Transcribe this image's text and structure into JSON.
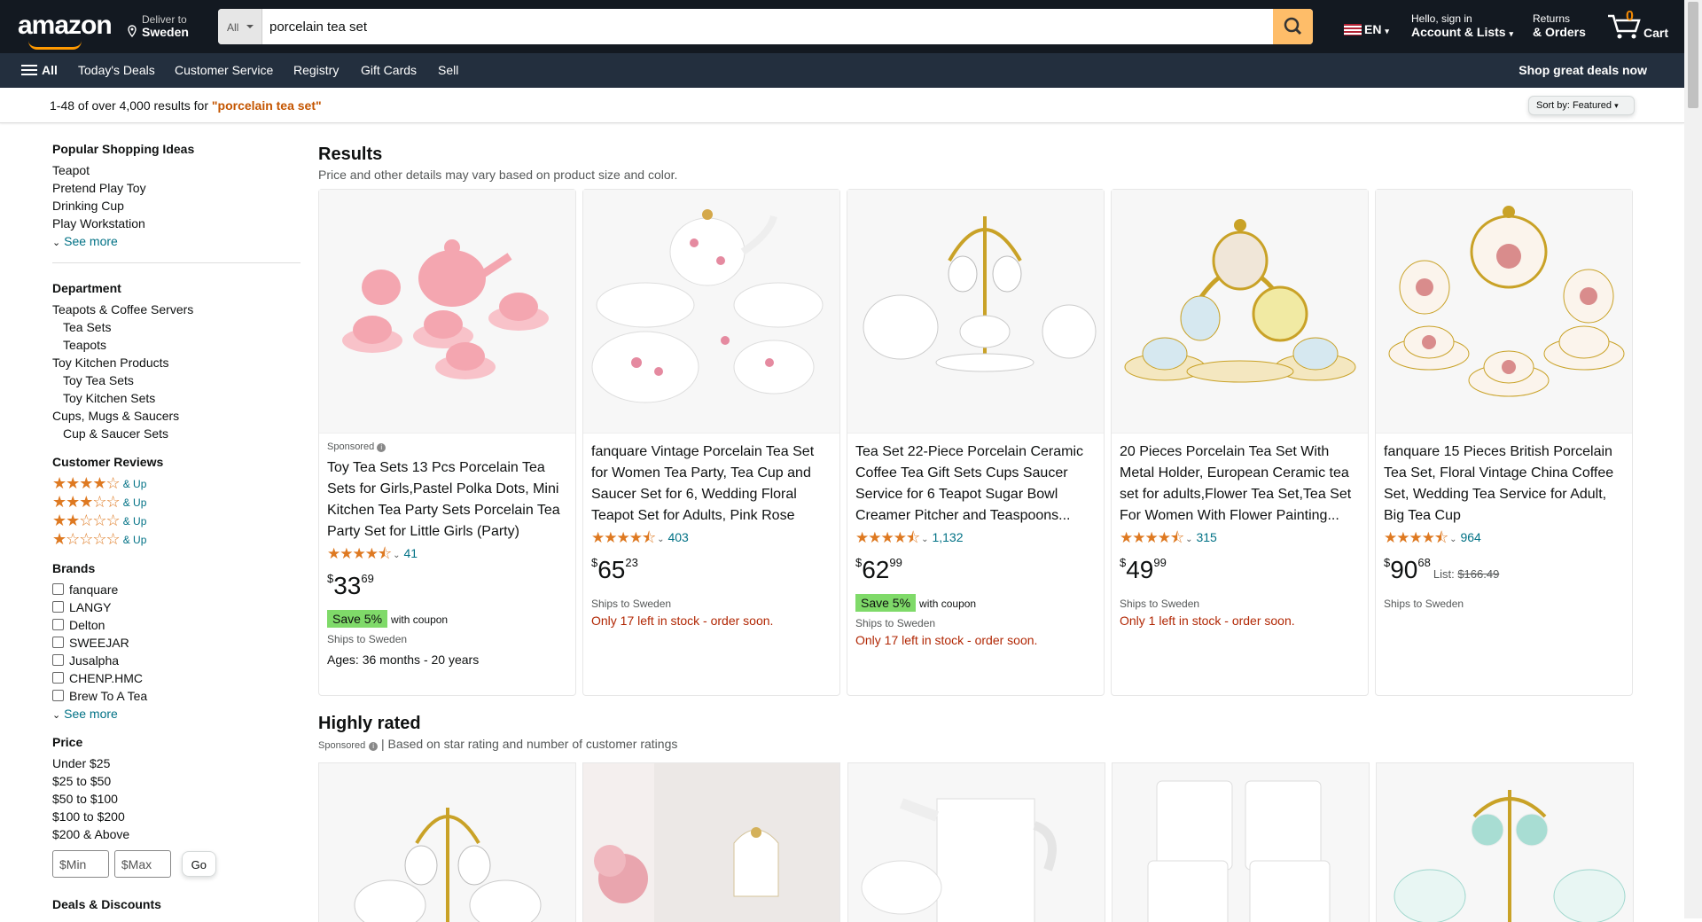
{
  "header": {
    "logo": "amazon",
    "deliver_label": "Deliver to",
    "deliver_country": "Sweden",
    "search_category": "All",
    "search_value": "porcelain tea set",
    "language": "EN",
    "account_greeting": "Hello, sign in",
    "account_label": "Account & Lists",
    "returns_label": "Returns",
    "orders_label": "& Orders",
    "cart_count": "0",
    "cart_label": "Cart"
  },
  "nav": {
    "all": "All",
    "items": [
      "Today's Deals",
      "Customer Service",
      "Registry",
      "Gift Cards",
      "Sell"
    ],
    "promo": "Shop great deals now"
  },
  "results_bar": {
    "prefix": "1-48 of over 4,000 results for ",
    "query": "\"porcelain tea set\"",
    "sort": "Sort by:  Featured"
  },
  "sidebar": {
    "popular_title": "Popular Shopping Ideas",
    "popular": [
      "Teapot",
      "Pretend Play Toy",
      "Drinking Cup",
      "Play Workstation"
    ],
    "see_more": "See more",
    "department_title": "Department",
    "departments": [
      {
        "label": "Teapots & Coffee Servers",
        "indent": false
      },
      {
        "label": "Tea Sets",
        "indent": true
      },
      {
        "label": "Teapots",
        "indent": true
      },
      {
        "label": "Toy Kitchen Products",
        "indent": false
      },
      {
        "label": "Toy Tea Sets",
        "indent": true
      },
      {
        "label": "Toy Kitchen Sets",
        "indent": true
      },
      {
        "label": "Cups, Mugs & Saucers",
        "indent": false
      },
      {
        "label": "Cup & Saucer Sets",
        "indent": true
      }
    ],
    "reviews_title": "Customer Reviews",
    "review_rows": [
      4,
      3,
      2,
      1
    ],
    "and_up": "& Up",
    "brands_title": "Brands",
    "brands": [
      "fanquare",
      "LANGY",
      "Delton",
      "SWEEJAR",
      "Jusalpha",
      "CHENP.HMC",
      "Brew To A Tea"
    ],
    "price_title": "Price",
    "prices": [
      "Under $25",
      "$25 to $50",
      "$50 to $100",
      "$100 to $200",
      "$200 & Above"
    ],
    "min_placeholder": "$Min",
    "max_placeholder": "$Max",
    "go": "Go",
    "deals_title": "Deals & Discounts"
  },
  "results": {
    "title": "Results",
    "subtitle": "Price and other details may vary based on product size and color.",
    "products": [
      {
        "sponsored": "Sponsored",
        "title": "Toy Tea Sets 13 Pcs Porcelain Tea Sets for Girls,Pastel Polka Dots, Mini Kitchen Tea Party Sets Porcelain Tea Party Set for Little Girls (Party)",
        "rating": 4.5,
        "reviews": "41",
        "price_whole": "33",
        "price_cents": "69",
        "list_price": "",
        "coupon": "Save 5%",
        "coupon_text": "with coupon",
        "ships": "Ships to Sweden",
        "stock": "",
        "ages": "Ages: 36 months - 20 years",
        "img": "pink"
      },
      {
        "sponsored": "",
        "title": "fanquare Vintage Porcelain Tea Set for Women Tea Party, Tea Cup and Saucer Set for 6, Wedding Floral Teapot Set for Adults, Pink Rose",
        "rating": 4.5,
        "reviews": "403",
        "price_whole": "65",
        "price_cents": "23",
        "list_price": "",
        "coupon": "",
        "coupon_text": "",
        "ships": "Ships to Sweden",
        "stock": "Only 17 left in stock - order soon.",
        "ages": "",
        "img": "floral"
      },
      {
        "sponsored": "",
        "title": "Tea Set 22-Piece Porcelain Ceramic Coffee Tea Gift Sets Cups Saucer Service for 6 Teapot Sugar Bowl Creamer Pitcher and Teaspoons...",
        "rating": 4.5,
        "reviews": "1,132",
        "price_whole": "62",
        "price_cents": "99",
        "list_price": "",
        "coupon": "Save 5%",
        "coupon_text": "with coupon",
        "ships": "Ships to Sweden",
        "stock": "Only 17 left in stock - order soon.",
        "ages": "",
        "img": "rack"
      },
      {
        "sponsored": "",
        "title": "20 Pieces Porcelain Tea Set With Metal Holder, European Ceramic tea set for adults,Flower Tea Set,Tea Set For Women With Flower Painting...",
        "rating": 4.5,
        "reviews": "315",
        "price_whole": "49",
        "price_cents": "99",
        "list_price": "",
        "coupon": "",
        "coupon_text": "",
        "ships": "Ships to Sweden",
        "stock": "Only 1 left in stock - order soon.",
        "ages": "",
        "img": "gold"
      },
      {
        "sponsored": "",
        "title": "fanquare 15 Pieces British Porcelain Tea Set, Floral Vintage China Coffee Set, Wedding Tea Service for Adult, Big Tea Cup",
        "rating": 4.5,
        "reviews": "964",
        "price_whole": "90",
        "price_cents": "68",
        "list_label": "List:",
        "list_price": "$166.49",
        "coupon": "",
        "coupon_text": "",
        "ships": "Ships to Sweden",
        "stock": "",
        "ages": "",
        "img": "british"
      }
    ]
  },
  "highly_rated": {
    "title": "Highly rated",
    "sponsored": "Sponsored",
    "subtitle": "| Based on star rating and number of customer ratings"
  },
  "colors": {
    "nav_dark": "#131921",
    "nav_secondary": "#232f3e",
    "accent": "#febd69",
    "link": "#007185",
    "star": "#de7921",
    "stock_red": "#b12704",
    "coupon_green": "#7fda69"
  }
}
